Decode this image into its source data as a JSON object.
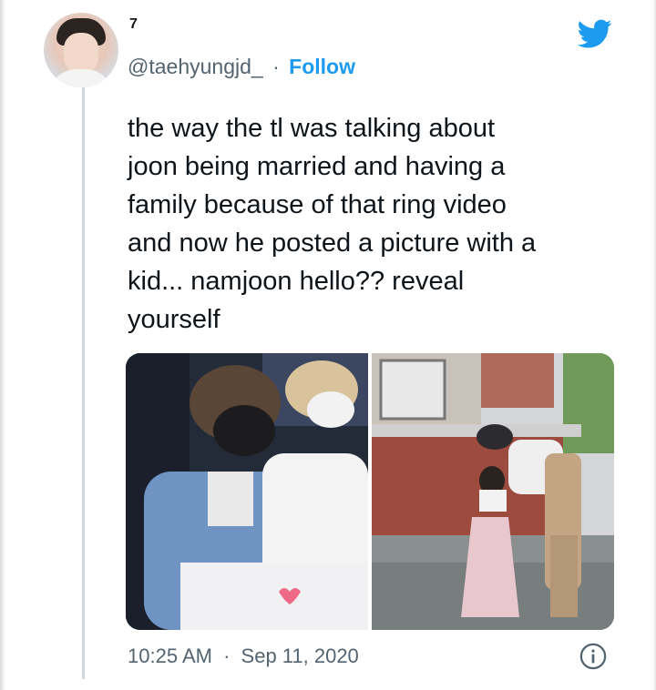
{
  "tweet": {
    "display_name": "7",
    "handle": "@taehyungjd_",
    "separator": "·",
    "follow_label": "Follow",
    "text": "the way the tl was talking about\njoon being married and having a\nfamily because of that ring video\nand now he posted a picture with a\nkid... namjoon hello?? reveal\nyourself",
    "time": "10:25 AM",
    "date_separator": "·",
    "date": "Sep 11, 2020"
  },
  "icons": {
    "brand": "twitter-bird-icon",
    "info": "info-icon"
  },
  "colors": {
    "accent": "#1d9bf0",
    "text_primary": "#0f1419",
    "text_secondary": "#536471",
    "thread_line": "#d0d6db"
  }
}
